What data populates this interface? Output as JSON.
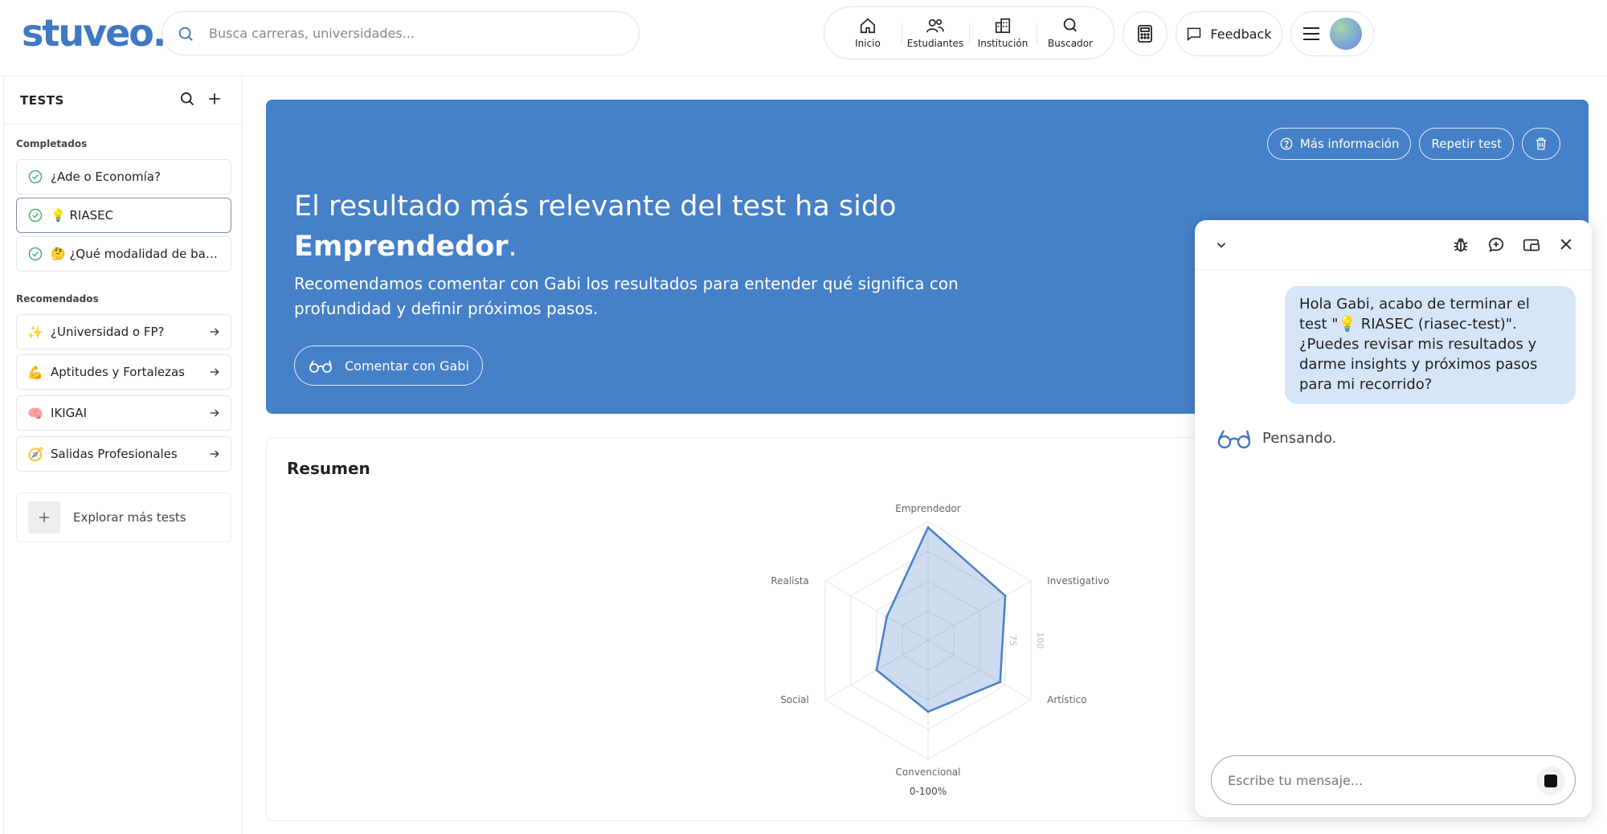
{
  "header": {
    "logo": "stuveo.",
    "search_placeholder": "Busca carreras, universidades...",
    "nav": [
      {
        "label": "Inicio",
        "icon": "home-icon"
      },
      {
        "label": "Estudiantes",
        "icon": "users-icon"
      },
      {
        "label": "Institución",
        "icon": "building-icon"
      },
      {
        "label": "Buscador",
        "icon": "search-icon"
      }
    ],
    "feedback_label": "Feedback"
  },
  "sidebar": {
    "title": "TESTS",
    "completed_label": "Completados",
    "completed": [
      {
        "label": "¿Ade o Economía?",
        "emoji": ""
      },
      {
        "label": "RIASEC",
        "emoji": "💡"
      },
      {
        "label": "¿Qué modalidad de bachillerato?",
        "emoji": "🤔"
      }
    ],
    "recommended_label": "Recomendados",
    "recommended": [
      {
        "label": "¿Universidad o FP?",
        "emoji": "✨"
      },
      {
        "label": "Aptitudes y Fortalezas",
        "emoji": "💪"
      },
      {
        "label": "IKIGAI",
        "emoji": "🧠"
      },
      {
        "label": "Salidas Profesionales",
        "emoji": "🧭"
      }
    ],
    "explore_label": "Explorar más tests"
  },
  "hero": {
    "title_prefix": "El resultado más relevante del test ha sido",
    "title_result": "Emprendedor",
    "title_suffix": ".",
    "paragraph": "Recomendamos comentar con Gabi los resultados para entender qué significa con profundidad y definir próximos pasos.",
    "comment_button": "Comentar con Gabi",
    "more_info_button": "Más información",
    "repeat_button": "Repetir test"
  },
  "resumen": {
    "title": "Resumen"
  },
  "chart_data": {
    "type": "radar",
    "categories": [
      "Emprendedor",
      "Investigativo",
      "Artístico",
      "Convencional",
      "Social",
      "Realista"
    ],
    "series": [
      {
        "values": [
          95,
          75,
          70,
          60,
          50,
          40
        ]
      }
    ],
    "range": [
      0,
      100
    ],
    "tick_labels": [
      "75",
      "100"
    ],
    "caption": "0-100%",
    "color": "#4a80c8"
  },
  "chat": {
    "user_message": "Hola Gabi, acabo de terminar el test \"💡 RIASEC (riasec-test)\". ¿Puedes revisar mis resultados y darme insights y próximos pasos para mi recorrido?",
    "status": "Pensando.",
    "input_placeholder": "Escribe tu mensaje..."
  }
}
